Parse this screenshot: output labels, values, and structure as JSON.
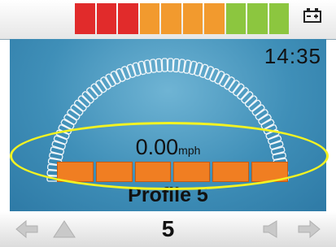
{
  "status_bar": {
    "battery_segments": [
      {
        "color": "#e12b2b"
      },
      {
        "color": "#e12b2b"
      },
      {
        "color": "#e12b2b"
      },
      {
        "color": "#f29a2e"
      },
      {
        "color": "#f29a2e"
      },
      {
        "color": "#f29a2e"
      },
      {
        "color": "#f29a2e"
      },
      {
        "color": "#8cc63f"
      },
      {
        "color": "#8cc63f"
      },
      {
        "color": "#8cc63f"
      }
    ],
    "battery_icon": "battery-icon"
  },
  "display": {
    "time": "14:35",
    "speed_value": "0.00",
    "speed_unit": "mph",
    "speed_bar_segments": 6,
    "profile_label": "Profile 5",
    "gauge_icon": "speedometer-arc"
  },
  "bottom_bar": {
    "profile_number": "5",
    "left_icons": [
      "arrow-left-icon",
      "triangle-warning-icon"
    ],
    "right_icons": [
      "horn-icon",
      "arrow-right-icon"
    ]
  },
  "colors": {
    "screen_blue": "#3f8fb8",
    "speed_bar": "#f07e22",
    "highlight": "#f3f322"
  }
}
